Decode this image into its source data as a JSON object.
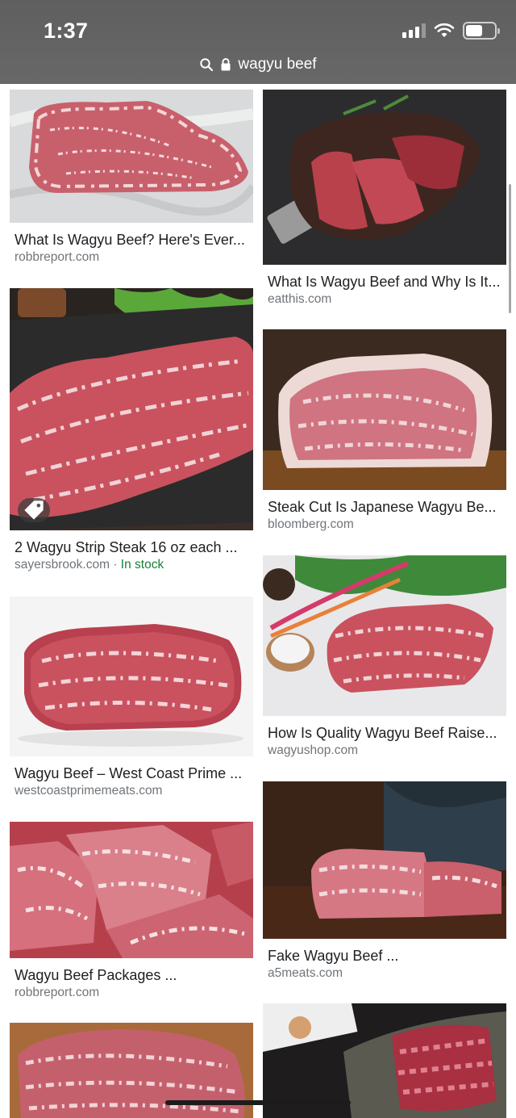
{
  "status_bar": {
    "time": "1:37"
  },
  "url_bar": {
    "query": "wagyu beef",
    "search_icon": "search-icon",
    "lock_icon": "lock-icon"
  },
  "results": [
    {
      "title": "What Is Wagyu Beef? Here's Ever...",
      "source": "robbreport.com"
    },
    {
      "title": "What Is Wagyu Beef and Why Is It...",
      "source": "eatthis.com"
    },
    {
      "title": "2 Wagyu Strip Steak 16 oz each ...",
      "source": "sayersbrook.com",
      "separator": " · ",
      "badge": "In stock"
    },
    {
      "title": "Steak Cut Is Japanese Wagyu Be...",
      "source": "bloomberg.com"
    },
    {
      "title": "Wagyu Beef – West Coast Prime ...",
      "source": "westcoastprimemeats.com"
    },
    {
      "title": "How Is Quality Wagyu Beef Raise...",
      "source": "wagyushop.com"
    },
    {
      "title": "Wagyu Beef Packages ...",
      "source": "robbreport.com"
    },
    {
      "title": "Fake Wagyu Beef ...",
      "source": "a5meats.com"
    }
  ],
  "colors": {
    "in_stock": "#188038",
    "source": "#70757a",
    "title": "#202124",
    "top_bar": "#636363"
  }
}
